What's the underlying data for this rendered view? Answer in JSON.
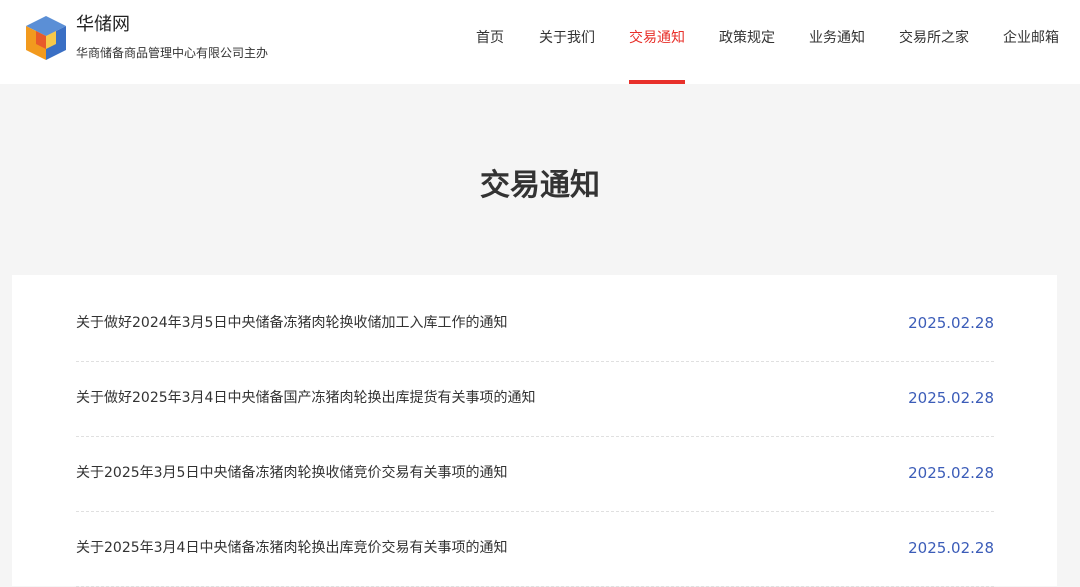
{
  "brand": {
    "name": "华储网",
    "subtitle": "华商储备商品管理中心有限公司主办"
  },
  "nav": {
    "items": [
      {
        "label": "首页"
      },
      {
        "label": "关于我们"
      },
      {
        "label": "交易通知",
        "active": true
      },
      {
        "label": "政策规定"
      },
      {
        "label": "业务通知"
      },
      {
        "label": "交易所之家"
      },
      {
        "label": "企业邮箱"
      }
    ]
  },
  "page": {
    "title": "交易通知"
  },
  "notices": [
    {
      "title": "关于做好2024年3月5日中央储备冻猪肉轮换收储加工入库工作的通知",
      "date": "2025.02.28"
    },
    {
      "title": "关于做好2025年3月4日中央储备国产冻猪肉轮换出库提货有关事项的通知",
      "date": "2025.02.28"
    },
    {
      "title": "关于2025年3月5日中央储备冻猪肉轮换收储竞价交易有关事项的通知",
      "date": "2025.02.28"
    },
    {
      "title": "关于2025年3月4日中央储备冻猪肉轮换出库竞价交易有关事项的通知",
      "date": "2025.02.28"
    }
  ],
  "colors": {
    "accent": "#e8302a",
    "date": "#3b5cb8",
    "background": "#f5f5f5"
  }
}
